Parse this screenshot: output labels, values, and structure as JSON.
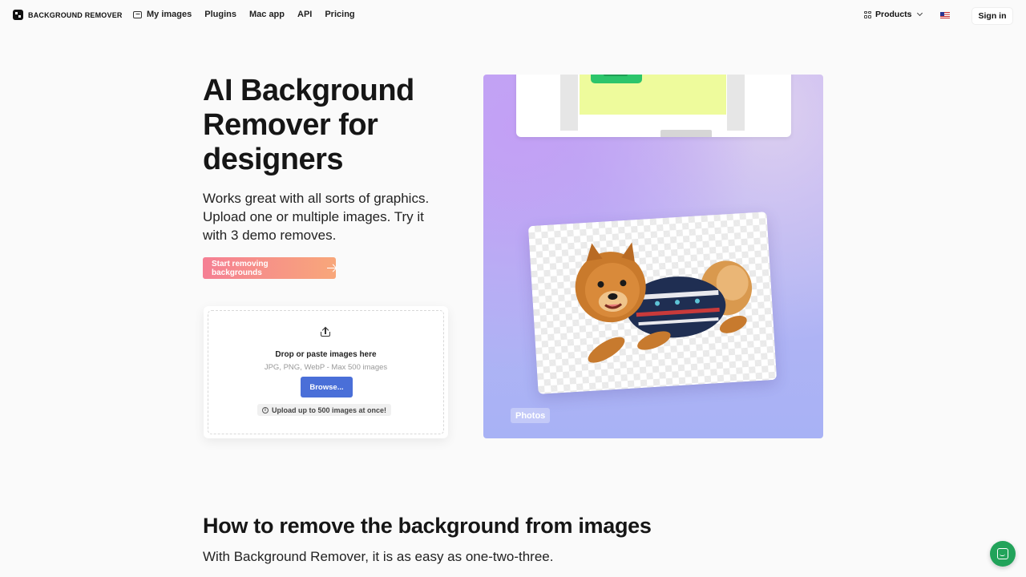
{
  "header": {
    "logo_text": "BACKGROUND REMOVER",
    "nav": [
      {
        "label": "My images",
        "icon": "image-icon"
      },
      {
        "label": "Plugins"
      },
      {
        "label": "Mac app"
      },
      {
        "label": "API"
      },
      {
        "label": "Pricing"
      }
    ],
    "products_label": "Products",
    "flag_icon": "us-flag-icon",
    "signin_label": "Sign in"
  },
  "hero": {
    "title": "AI Background Remover for designers",
    "subtitle": "Works great with all sorts of graphics. Upload one or multiple images. Try it with 3 demo removes.",
    "cta_label": "Start removing backgrounds",
    "cta_gradient": [
      "#f57f94",
      "#f8a77a"
    ]
  },
  "upload": {
    "title": "Drop or paste images here",
    "formats": "JPG, PNG, WebP - Max 500 images",
    "browse_label": "Browse...",
    "hint": "Upload up to 500 images at once!",
    "browse_color": "#4a6fd8"
  },
  "showcase": {
    "badge": "Photos"
  },
  "howto": {
    "title": "How to remove the background from images",
    "subtitle": "With Background Remover, it is as easy as one-two-three."
  },
  "chat": {
    "icon": "chat-icon",
    "color": "#22a35a"
  }
}
